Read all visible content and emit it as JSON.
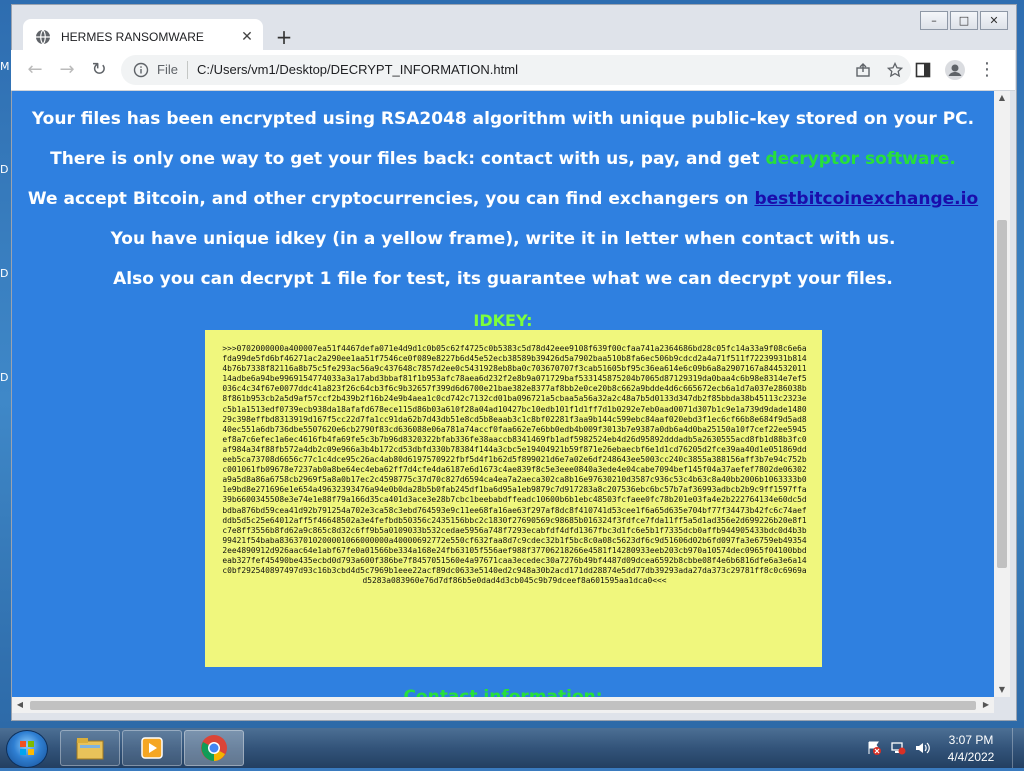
{
  "desktop": {
    "edge_letters": [
      "M",
      "D",
      "D",
      "D"
    ]
  },
  "window_controls": {
    "minimize": "–",
    "maximize": "□",
    "close": "✕"
  },
  "tab": {
    "title": "HERMES RANSOMWARE",
    "close": "✕",
    "new_tab": "+"
  },
  "toolbar": {
    "back": "←",
    "forward": "→",
    "reload": "↻",
    "url_scheme": "File",
    "url": "C:/Users/vm1/Desktop/DECRYPT_INFORMATION.html",
    "menu": "⋮"
  },
  "page": {
    "line1": "Your files has been encrypted using RSA2048 algorithm with unique public-key stored on your PC.",
    "line2_prefix": "There is  only one way   to get your files back:  contact with us,  pay,  and get ",
    "line2_green": "decryptor software.",
    "line3_prefix": "We accept Bitcoin, and other cryptocurrencies,  you can find exchangers on ",
    "line3_link": "bestbitcoinexchange.io",
    "line4": "You have unique idkey (in a yellow frame), write it in letter when contact with us.",
    "line5": "Also you can decrypt 1 file for test, its guarantee what we can decrypt your files.",
    "idkey_title": "IDKEY:",
    "idkey": ">>>0702000000a400007ea51f4467defa071e4d9d1c0b05c62f4725c0b5383c5d78d42eee9108f639f00cfaa741a2364686bd28c05fc14a33a9f08c6e6afda99de5fd6bf46271ac2a290ee1aa51f7546ce0f089e8227b6d45e52ecb38589b39426d5a7902baa510b8fa6ec506b9cdcd2a4a71f511f72239931b8144b76b7338f82116a8b75c5fe293ac56a9c437648c7857d2ee0c5431928eb8ba0c703670707f3cab51605bf95c36ea614e6c09b6a8a2907167a84453201114adbe6a94be9969154774033a3a17abd3bbaf81f1b953afc78aea6d232f2e8b9a071729baf533145875204b7065d87129319da0baa4c6b98e8314e7ef5036c4c34f67e0077ddc41a823f26c64cb3f6c9b32657f399d6d6700e21bae382e8377af8bb2e0ce20b8c662a9bdde4d6c665672ecb6a1d7a037e286038b8f861b953cb2a5d9af57ccf2b439b2f16b24e9b4aea1c0cd742c7132cd01ba096721a5cbaa5a56a32a2c48a7b5d0133d347db2f85bbda38b45113c2323ec5b1a1513edf0739ecb938da18afafd678ece115d86b03a610f28a04ad10427bc10edb101f1d1ff7d1b0292e7eb0aad0071d307b1c9e1a739d9dade148029c398effbd8313919d167f5cc22d7fa1cc91da62b7d43db51e8cd5b8eaab3c1c8bf02281f3aa9b144c599ebc84aaf020ebd3f1ec6cf66b8e684f9d5ad840ec551a6db736dbe5507620e6cb2790f83cd636088e06a781a74accf0faa662e7e6bb0edb4b009f3013b7e9387a0db6a4d0ba25150a10f7cef22ee5945ef8a7c6efec1a6ec4616fb4fa69fe5c3b7b96d8320322bfab336fe38aaccb8341469fb1adf5982524eb4d26d95892dddadb5a2630555acd8fb1d88b3fc0af984a34f88fb572a4db2c09e966a3b4b172cd53dbfd330b78384f144a3cbc5e19404921b59f871e26ebaecbf6e1d1cd76205d2fce39aa40d1e051869ddeeb5ca73708d6656c77c1c4dce95c26ac4ab80d6197570922fbf5d4f1b62d5f899021d6e7a02e6df248643ee5003cc240c3855a388156aff3b7e94c752bc001061fb09678e7237ab0a8be64ec4eba62ff7d4cfe4da6187e6d1673c4ae839f8c5e3eee0840a3ede4e04cabe7094bef145f04a37aefef7802de06302a9a5d8a86a6758cb2969f5a8a0b17ec2c4598775c37d70c827d6594ca4ea7a2aeca302ca8b16e97630210d3587c936c53c4b63c8a40bb2006b1063333b01e9bd8e271696e1e654a49632393476a94e0b0da28b5b0fab245df1ba6d95a1eb9879c7d917283a8c207536ebc6bc57b7af36993adbcb2b9c9ff1597ffa39b6600345508e3e74e1e88f79a166d35ca401d3ace3e28b7cbc1beebabdffeadc10600b6b1ebc48503fcfaee0fc78b201e03fa4e2b222764134e60dc5dbdba876bd59cea41d92b791254a702e3ca58c3ebd764593e9c11ee68fa16ae63f297af8dc8f410741d53cee1f6a65d635e704bf77f34473b42fc6c74aefddb5d5c25e64012aff5f46648502a3e4fefbdb50356c2435156bbc2c1830f27690569c98685b016324f3fdfce7fda11ff5a5d1ad356e2d699226b20e8f1c7e8ff3556b8fd62a9c865c8d32c6ff9b5a0109033b532cedae5956a748f7293ecabfdf4dfd1367fbc3d1fc6e5b1f7335dcb0affb944905433bdc0d4b3b99421f54baba83637010200001066000000a40000692772e550cf632faa8d7c9cdec32b1f5bc8c0a08c5623df6c9d51606d02b6fd097fa3e6759eb493542ee4890912d926aac64e1abf67fe0a01566be334a168e24fb63105f556aef988f37706218266e4581f14280933eeb203cb970a10574dec0965f04100bbdeab327fef45490be435ecbd0d793a600f386be7f8457051560e4a97671caa3ecedec30a7276b49bf4487d09dcea6592b8cbbe08f4e6b6816dfe6a3e6a14c0bf292540897497d93c16b3cbd4d5c7969b1eee22acf89dc0633e5140ed2c948a30b2acd171dd28874e5dd77db39293ada27da373c29781ff8c0c6969ad5283a083960e76d7df86b5e0dad4d3cb045c9b79dceef8a601595aa1dca0<<<",
    "contact_heading": "Contact information:"
  },
  "taskbar": {
    "items": [
      "explorer-icon",
      "media-player-icon",
      "chrome-icon"
    ]
  },
  "clock": {
    "time": "3:07 PM",
    "date": "4/4/2022"
  }
}
